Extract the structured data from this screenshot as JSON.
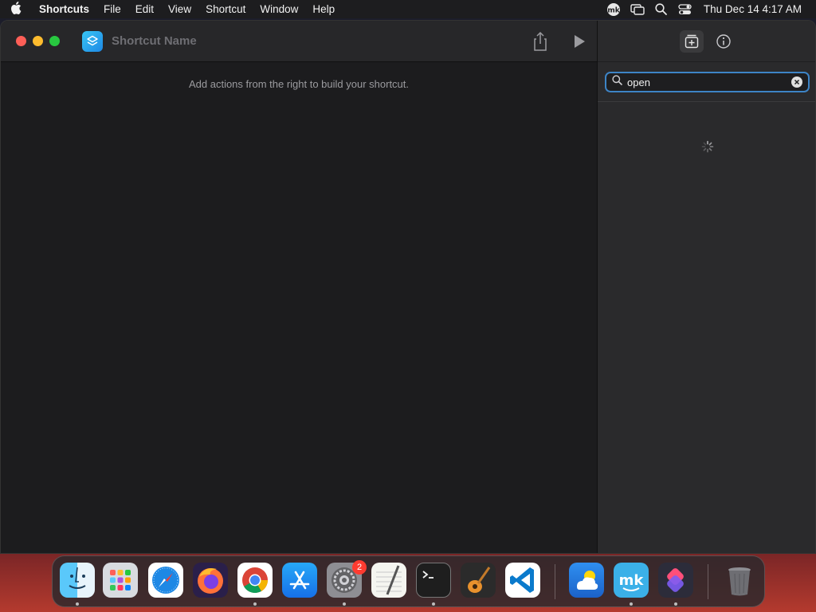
{
  "menubar": {
    "app_name": "Shortcuts",
    "items": [
      "File",
      "Edit",
      "View",
      "Shortcut",
      "Window",
      "Help"
    ],
    "clock": "Thu Dec 14  4:17 AM"
  },
  "window": {
    "shortcut_name": "Shortcut Name",
    "editor_hint": "Add actions from the right to build your shortcut."
  },
  "sidebar": {
    "search_value": "open"
  },
  "dock": {
    "settings_badge": "2"
  },
  "colors": {
    "accent": "#3d84c6",
    "close": "#fe5f57",
    "minimize": "#febc2e",
    "maximize": "#28c840"
  }
}
